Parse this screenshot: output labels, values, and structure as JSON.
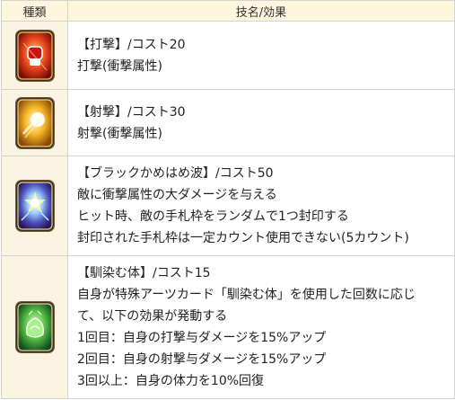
{
  "header": {
    "col_type": "種類",
    "col_effect": "技名/効果"
  },
  "rows": [
    {
      "icon": "strike-card-icon",
      "lines": [
        "【打撃】/コスト20",
        "打撃(衝撃属性)"
      ]
    },
    {
      "icon": "shoot-card-icon",
      "lines": [
        "【射撃】/コスト30",
        "射撃(衝撃属性)"
      ]
    },
    {
      "icon": "black-kamehameha-card-icon",
      "lines": [
        "【ブラックかめはめ波】/コスト50",
        "敵に衝撃属性の大ダメージを与える",
        "ヒット時、敵の手札枠をランダムで1つ封印する",
        "封印された手札枠は一定カウント使用できない(5カウント)"
      ]
    },
    {
      "icon": "familiar-body-card-icon",
      "lines": [
        "【馴染む体】/コスト15",
        "自身が特殊アーツカード「馴染む体」を使用した回数に応じ",
        "て、以下の効果が発動する",
        "1回目：自身の打撃与ダメージを15%アップ",
        "2回目：自身の射撃与ダメージを15%アップ",
        "3回以上：自身の体力を10%回復"
      ]
    }
  ]
}
